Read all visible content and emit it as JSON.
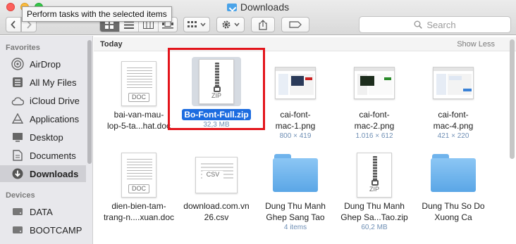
{
  "window": {
    "title": "Downloads",
    "tooltip": "Perform tasks with the selected items"
  },
  "toolbar": {
    "back_icon": "chevron-left-icon",
    "forward_icon": "chevron-right-icon",
    "views": [
      "icon-view",
      "list-view",
      "column-view",
      "cover-flow-view"
    ],
    "active_view": "icon-view",
    "search_placeholder": "Search"
  },
  "sidebar": {
    "favorites_label": "Favorites",
    "favorites": [
      {
        "label": "AirDrop",
        "icon": "airdrop-icon"
      },
      {
        "label": "All My Files",
        "icon": "all-files-icon"
      },
      {
        "label": "iCloud Drive",
        "icon": "cloud-icon"
      },
      {
        "label": "Applications",
        "icon": "applications-icon"
      },
      {
        "label": "Desktop",
        "icon": "desktop-icon"
      },
      {
        "label": "Documents",
        "icon": "documents-icon"
      },
      {
        "label": "Downloads",
        "icon": "downloads-icon",
        "selected": true
      }
    ],
    "devices_label": "Devices",
    "devices": [
      {
        "label": "DATA",
        "icon": "disk-icon"
      },
      {
        "label": "BOOTCAMP",
        "icon": "disk-icon"
      }
    ]
  },
  "content": {
    "group_title": "Today",
    "show_less": "Show Less",
    "files": [
      {
        "name_line1": "bai-van-mau-",
        "name_line2": "lop-5-ta...hat.doc",
        "meta": "",
        "kind": "doc",
        "badge": "DOC"
      },
      {
        "name_line1": "Bo-Font-Full.zip",
        "name_line2": "",
        "meta": "32,3 MB",
        "kind": "zip",
        "badge": "ZIP",
        "selected": true
      },
      {
        "name_line1": "cai-font-",
        "name_line2": "mac-1.png",
        "meta": "800 × 419",
        "kind": "png"
      },
      {
        "name_line1": "cai-font-",
        "name_line2": "mac-2.png",
        "meta": "1.016 × 612",
        "kind": "png"
      },
      {
        "name_line1": "cai-font-",
        "name_line2": "mac-4.png",
        "meta": "421 × 220",
        "kind": "png"
      },
      {
        "name_line1": "dien-bien-tam-",
        "name_line2": "trang-n....xuan.doc",
        "meta": "",
        "kind": "doc",
        "badge": "DOC"
      },
      {
        "name_line1": "download.com.vn",
        "name_line2": "26.csv",
        "meta": "",
        "kind": "csv",
        "badge": "CSV"
      },
      {
        "name_line1": "Dung Thu Manh",
        "name_line2": "Ghep Sang Tao",
        "meta": "4 items",
        "kind": "folder"
      },
      {
        "name_line1": "Dung Thu Manh",
        "name_line2": "Ghep Sa...Tao.zip",
        "meta": "60,2 MB",
        "kind": "zip",
        "badge": "ZIP"
      },
      {
        "name_line1": "Dung Thu So Do",
        "name_line2": "Xuong Ca",
        "meta": "",
        "kind": "folder"
      }
    ]
  },
  "colors": {
    "accent": "#1c6ce0",
    "highlight": "#e3141b",
    "folder": "#5aa6e6"
  }
}
